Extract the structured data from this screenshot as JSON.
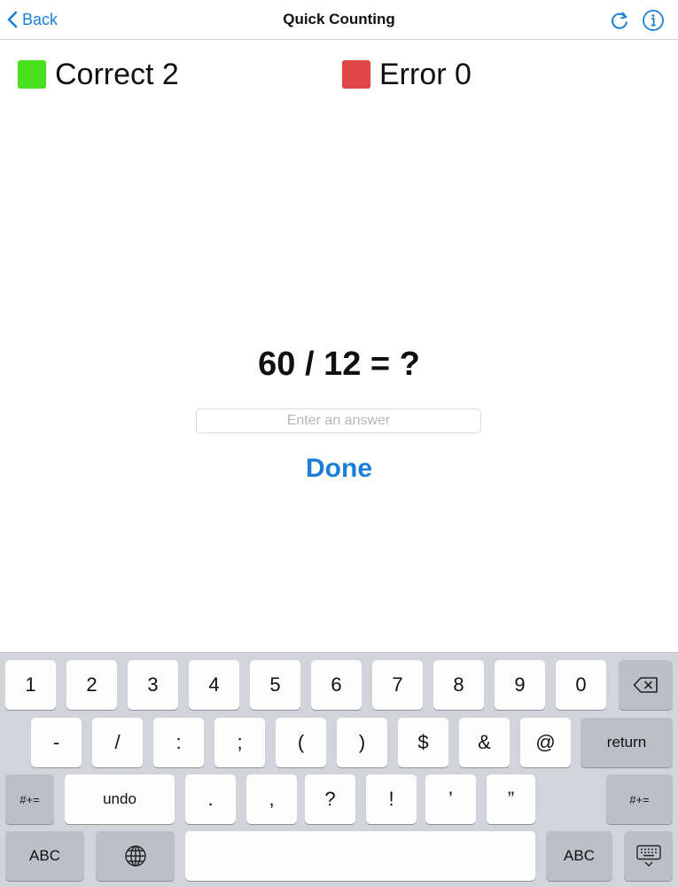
{
  "nav": {
    "back_label": "Back",
    "title": "Quick Counting",
    "icons": [
      "chevron-left-icon",
      "refresh-icon",
      "info-icon"
    ]
  },
  "score": {
    "correct_label": "Correct 2",
    "error_label": "Error 0",
    "correct_color": "#4ae01f",
    "error_color": "#e04646"
  },
  "quiz": {
    "question": "60 / 12 = ?",
    "answer_value": "",
    "answer_placeholder": "Enter an answer",
    "done_label": "Done"
  },
  "keyboard": {
    "row1": [
      "1",
      "2",
      "3",
      "4",
      "5",
      "6",
      "7",
      "8",
      "9",
      "0"
    ],
    "row2": [
      "-",
      "/",
      ":",
      ";",
      "(",
      ")",
      "$",
      "&",
      "@"
    ],
    "return_label": "return",
    "symbols_label": "#+=",
    "undo_label": "undo",
    "row3": [
      ".",
      ",",
      "?",
      "!",
      "’",
      "”"
    ],
    "abc_label": "ABC",
    "icons": [
      "backspace-icon",
      "globe-icon",
      "keyboard-dismiss-icon"
    ],
    "accent_color": "#1a7fd7"
  }
}
